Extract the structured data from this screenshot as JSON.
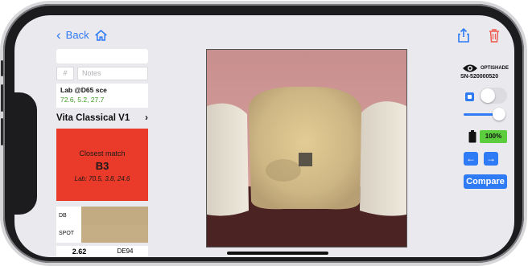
{
  "nav": {
    "back_label": "Back"
  },
  "left": {
    "notes_hash": "#",
    "notes_placeholder": "Notes",
    "lab_title": "Lab @D65 sce",
    "lab_values": "72.6, 5.2, 27.7",
    "shade_guide": "Vita Classical V1",
    "closest_match_label": "Closest match",
    "closest_match_shade": "B3",
    "closest_match_lab": "Lab: 70.5, 3.8, 24.6",
    "compare_db_label": "DB",
    "compare_spot_label": "SPOT",
    "delta_value": "2.62",
    "delta_label": "DE94"
  },
  "right": {
    "brand": "OPTISHADE",
    "serial": "SN-520000520",
    "battery_percent": "100%",
    "compare_button": "Compare"
  },
  "colors": {
    "accent": "#2f7af5",
    "match_bg": "#ea3b2a",
    "battery_green": "#5ccd3d",
    "swatch": "#c2aa83"
  }
}
